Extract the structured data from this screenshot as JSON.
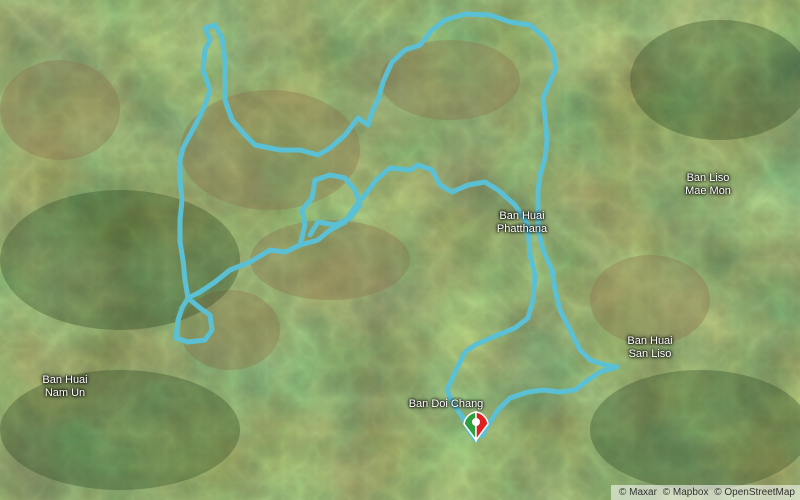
{
  "map": {
    "route_color": "#5bc0d4",
    "start_marker_color": "#2e9e3e",
    "finish_marker_color": "#e02020",
    "places": [
      {
        "id": "ban-liso-mae-mon",
        "lines": [
          "Ban Liso",
          "Mae Mon"
        ]
      },
      {
        "id": "ban-huai-phatthana",
        "lines": [
          "Ban Huai",
          "Phatthana"
        ]
      },
      {
        "id": "ban-huai-san-liso",
        "lines": [
          "Ban Huai",
          "San Liso"
        ]
      },
      {
        "id": "ban-huai-nam-un",
        "lines": [
          "Ban Huai",
          "Nam Un"
        ]
      },
      {
        "id": "ban-doi-chang",
        "lines": [
          "Ban Doi Chang"
        ]
      }
    ]
  },
  "attribution": [
    "© Maxar",
    "© Mapbox",
    "© OpenStreetMap"
  ]
}
